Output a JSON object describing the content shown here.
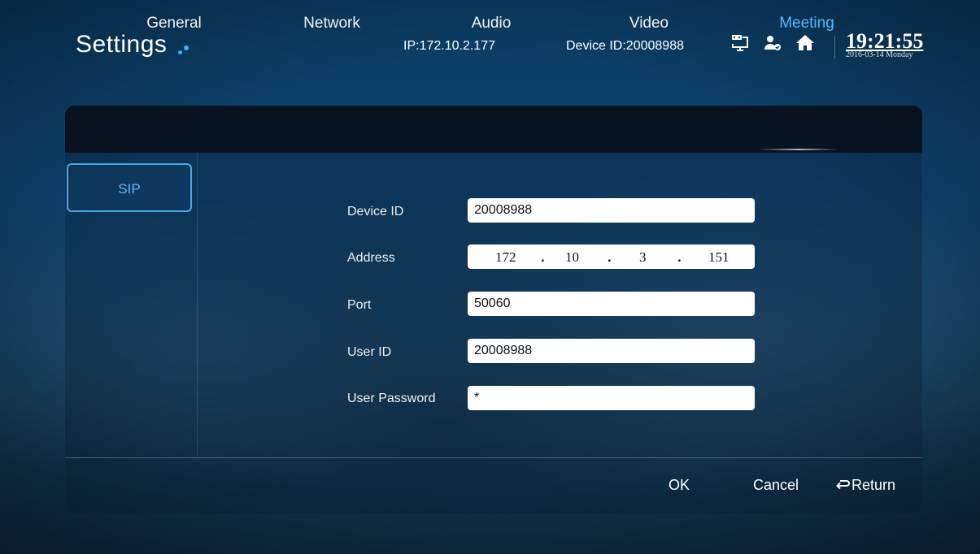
{
  "header": {
    "title": "Settings",
    "ip": "IP:172.10.2.177",
    "device_id": "Device ID:20008988",
    "time": "19:21:55",
    "date": "2016-03-14 Monday",
    "icons": [
      "network-icon",
      "user-status-icon",
      "home-icon"
    ]
  },
  "tabs": [
    "General",
    "Network",
    "Audio",
    "Video",
    "Meeting"
  ],
  "active_tab": "Meeting",
  "sidebar": {
    "items": [
      {
        "label": "SIP"
      }
    ]
  },
  "form": {
    "device_id": {
      "label": "Device ID",
      "value": "20008988"
    },
    "address": {
      "label": "Address",
      "octets": [
        "172",
        "10",
        "3",
        "151"
      ],
      "separator": "."
    },
    "port": {
      "label": "Port",
      "value": "50060"
    },
    "user_id": {
      "label": "User ID",
      "value": "20008988"
    },
    "user_password": {
      "label": "User Password",
      "value": "*"
    }
  },
  "footer": {
    "ok": "OK",
    "cancel": "Cancel",
    "return": "Return"
  },
  "colors": {
    "accent": "#55b6ff",
    "sidebar_border": "#4aa7ea",
    "tabbar_bg": "#080e16"
  }
}
